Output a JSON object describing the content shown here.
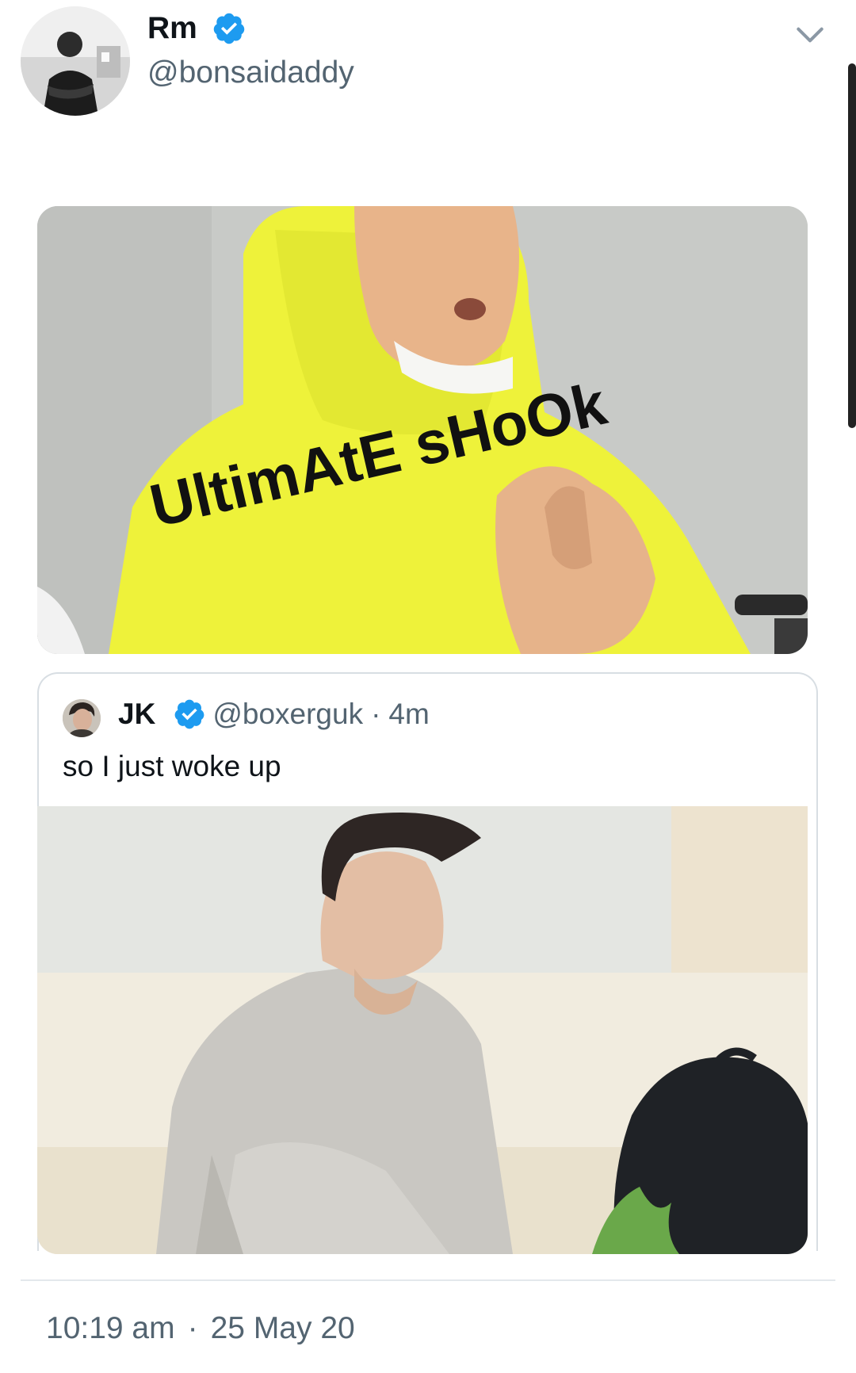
{
  "tweet": {
    "author_name": "Rm",
    "author_handle": "@bonsaidaddy",
    "verified": true,
    "media_caption": "UltimAtE sHoOk",
    "time": "10:19 am",
    "separator": "·",
    "date": "25 May 20"
  },
  "quoted_tweet": {
    "author_name": "JK",
    "author_handle": "@boxerguk",
    "separator": "·",
    "time_ago": "4m",
    "text": "so I just woke up",
    "verified": true
  },
  "colors": {
    "verified_blue": "#1d9bf0",
    "secondary_text": "#536471",
    "primary_text": "#0f1419",
    "hoodie_yellow": "#eef23a"
  }
}
